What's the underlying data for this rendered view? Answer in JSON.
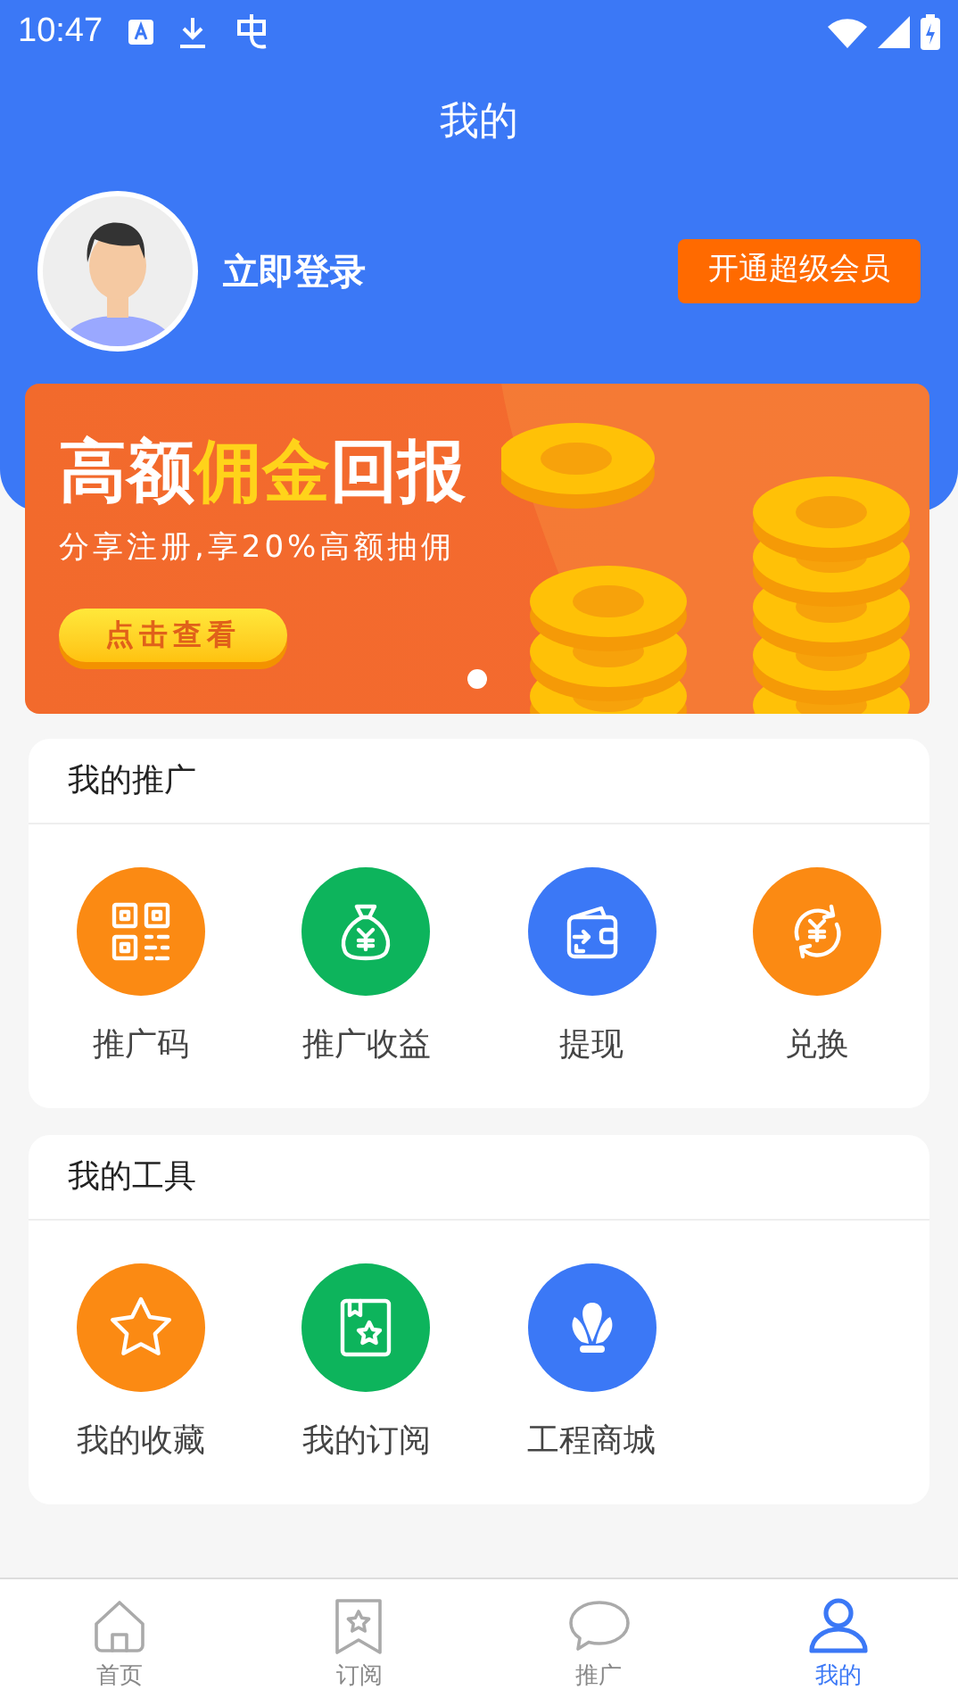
{
  "status_bar": {
    "time": "10:47"
  },
  "header": {
    "title": "我的"
  },
  "profile": {
    "login_text": "立即登录",
    "vip_button": "开通超级会员"
  },
  "banner": {
    "title_parts": [
      {
        "text": "高额",
        "highlight": false
      },
      {
        "text": "佣金",
        "highlight": true
      },
      {
        "text": "回报",
        "highlight": false
      }
    ],
    "subtitle": "分享注册,享20%高额抽佣",
    "button": "点击查看",
    "dots": [
      {
        "selected": true
      }
    ]
  },
  "sections": [
    {
      "title": "我的推广",
      "items": [
        {
          "label": "推广码",
          "kind": "qr",
          "color": "#fb8a13"
        },
        {
          "label": "推广收益",
          "kind": "moneybag",
          "color": "#0db45c"
        },
        {
          "label": "提现",
          "kind": "wallet",
          "color": "#3b78f6"
        },
        {
          "label": "兑换",
          "kind": "exchange",
          "color": "#fb8a13"
        }
      ]
    },
    {
      "title": "我的工具",
      "items": [
        {
          "label": "我的收藏",
          "kind": "star",
          "color": "#fb8a13"
        },
        {
          "label": "我的订阅",
          "kind": "book",
          "color": "#0db45c"
        },
        {
          "label": "工程商城",
          "kind": "shell",
          "color": "#3b78f6"
        }
      ]
    }
  ],
  "tab_bar": [
    {
      "label": "首页",
      "kind": "home",
      "selected": false
    },
    {
      "label": "订阅",
      "kind": "bookmark",
      "selected": false
    },
    {
      "label": "推广",
      "kind": "chat",
      "selected": false
    },
    {
      "label": "我的",
      "kind": "user",
      "selected": true
    }
  ]
}
